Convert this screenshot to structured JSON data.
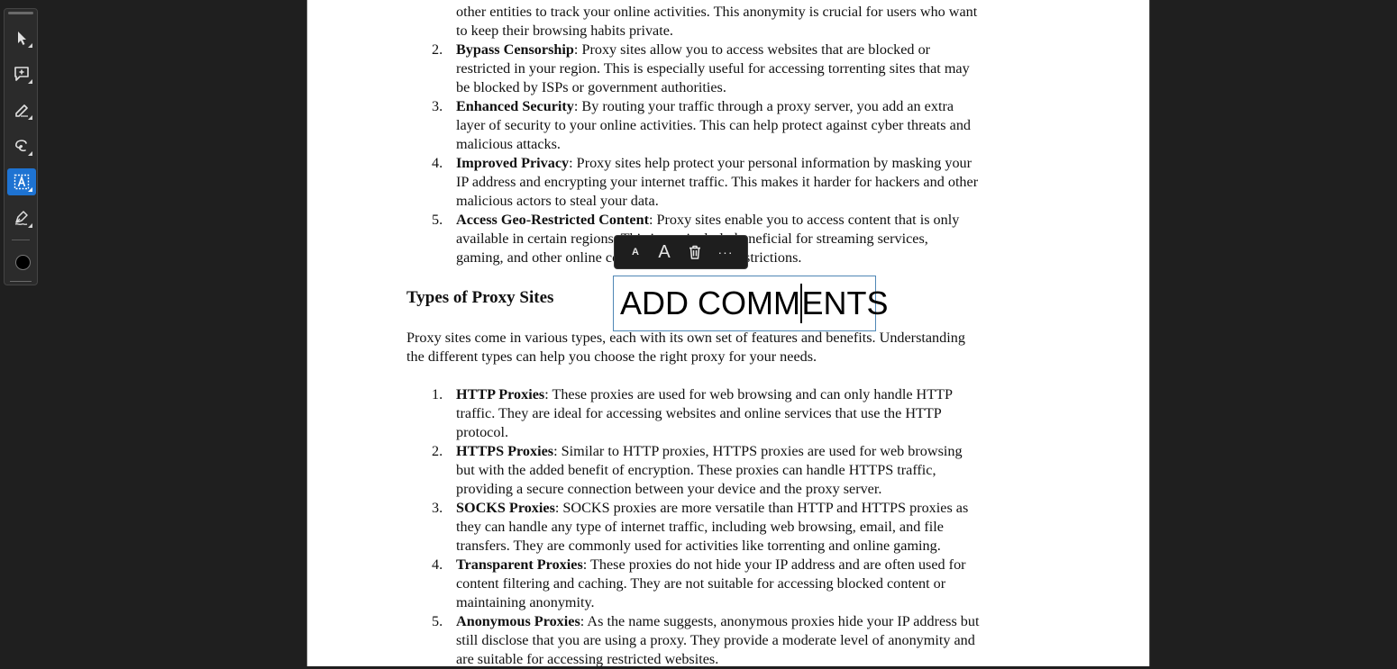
{
  "tool_rail": {
    "tools": [
      {
        "name": "select-tool",
        "icon": "cursor-arrow-icon",
        "active": false
      },
      {
        "name": "add-comment-tool",
        "icon": "comment-plus-icon",
        "active": false
      },
      {
        "name": "highlight-tool",
        "icon": "highlighter-icon",
        "active": false
      },
      {
        "name": "draw-tool",
        "icon": "lasso-icon",
        "active": false
      },
      {
        "name": "text-box-tool",
        "icon": "text-box-icon",
        "active": true
      },
      {
        "name": "signature-tool",
        "icon": "pen-sign-icon",
        "active": false
      }
    ],
    "current_color": "#000000",
    "accent_color": "#1e73d2"
  },
  "document": {
    "item1_tail": [
      "other entities to track your online activities. This anonymity is crucial for users who want",
      "to keep their browsing habits private."
    ],
    "list1": [
      {
        "num": "2.",
        "title": "Bypass Censorship",
        "lines": [
          ": Proxy sites allow you to access websites that are blocked or",
          "restricted in your region. This is especially useful for accessing torrenting sites that may",
          "be blocked by ISPs or government authorities."
        ]
      },
      {
        "num": "3.",
        "title": "Enhanced Security",
        "lines": [
          ": By routing your traffic through a proxy server, you add an extra",
          "layer of security to your online activities. This can help protect against cyber threats and",
          "malicious attacks."
        ]
      },
      {
        "num": "4.",
        "title": "Improved Privacy",
        "lines": [
          ": Proxy sites help protect your personal information by masking your",
          "IP address and encrypting your internet traffic. This makes it harder for hackers and other",
          "malicious actors to steal your data."
        ]
      },
      {
        "num": "5.",
        "title": "Access Geo-Restricted Content",
        "lines": [
          ": Proxy sites enable you to access content that is only",
          "available in certain regions. This is particularly beneficial for streaming services,",
          "gaming, and other online content with regional restrictions."
        ]
      }
    ],
    "section_heading": "Types of Proxy Sites",
    "intro": [
      "Proxy sites come in various types, each with its own set of features and benefits. Understanding",
      "the different types can help you choose the right proxy for your needs."
    ],
    "list2": [
      {
        "num": "1.",
        "title": "HTTP Proxies",
        "lines": [
          ": These proxies are used for web browsing and can only handle HTTP",
          "traffic. They are ideal for accessing websites and online services that use the HTTP",
          "protocol."
        ]
      },
      {
        "num": "2.",
        "title": "HTTPS Proxies",
        "lines": [
          ": Similar to HTTP proxies, HTTPS proxies are used for web browsing",
          "but with the added benefit of encryption. These proxies can handle HTTPS traffic,",
          "providing a secure connection between your device and the proxy server."
        ]
      },
      {
        "num": "3.",
        "title": "SOCKS Proxies",
        "lines": [
          ": SOCKS proxies are more versatile than HTTP and HTTPS proxies as",
          "they can handle any type of internet traffic, including web browsing, email, and file",
          "transfers. They are commonly used for activities like torrenting and online gaming."
        ]
      },
      {
        "num": "4.",
        "title": "Transparent Proxies",
        "lines": [
          ": These proxies do not hide your IP address and are often used for",
          "content filtering and caching. They are not suitable for accessing blocked content or",
          "maintaining anonymity."
        ]
      },
      {
        "num": "5.",
        "title": "Anonymous Proxies",
        "lines": [
          ": As the name suggests, anonymous proxies hide your IP address but",
          "still disclose that you are using a proxy. They provide a moderate level of anonymity and",
          "are suitable for accessing restricted websites."
        ]
      }
    ]
  },
  "annotation_toolbar": {
    "decrease_font_label": "A",
    "increase_font_label": "A",
    "delete_icon": "trash-icon",
    "more_label": "···"
  },
  "text_box": {
    "before_caret": "ADD COMM",
    "after_caret": "ENTS"
  }
}
